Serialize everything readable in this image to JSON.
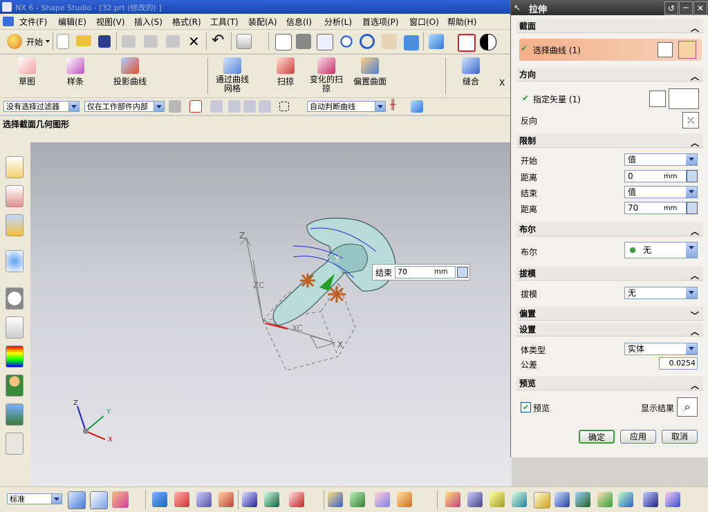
{
  "window": {
    "title": "NX 6 - Shape Studio - [32.prt (修改的) ]"
  },
  "menu": [
    "文件(F)",
    "编辑(E)",
    "视图(V)",
    "插入(S)",
    "格式(R)",
    "工具(T)",
    "装配(A)",
    "信息(I)",
    "分析(L)",
    "首选项(P)",
    "窗口(O)",
    "帮助(H)"
  ],
  "toolbar": {
    "start_label": "开始",
    "curve_buttons": [
      "草图",
      "样条",
      "投影曲线"
    ],
    "surface_buttons": [
      "通过曲线网格",
      "扫掠",
      "变化的扫掠",
      "偏置曲面",
      "缝合"
    ],
    "surface_extra": "X"
  },
  "selection_bar": {
    "filter": "没有选择过滤器",
    "scope": "仅在工作部件内部",
    "curve_rule": "自动判断曲线"
  },
  "cue": "选择截面几何图形",
  "viewport": {
    "axis_labels": {
      "z": "Z",
      "y": "Y",
      "x": "X",
      "zc": "ZC",
      "xc": "XC"
    },
    "triad": {
      "z": "Z",
      "y": "Y",
      "x": "X"
    },
    "onscreen_input": {
      "label": "结束",
      "value": "70",
      "unit": "mm"
    }
  },
  "dialog": {
    "title": "拉伸",
    "section": {
      "header": "截面",
      "select_curve": "选择曲线 (1)"
    },
    "direction": {
      "header": "方向",
      "specify_vector": "指定矢量 (1)",
      "reverse": "反向"
    },
    "limits": {
      "header": "限制",
      "start_label": "开始",
      "start_value": "值",
      "dist1_label": "距离",
      "dist1_value": "0",
      "dist1_unit": "mm",
      "end_label": "结束",
      "end_value": "值",
      "dist2_label": "距离",
      "dist2_value": "70",
      "dist2_unit": "mm"
    },
    "boolean": {
      "header": "布尔",
      "label": "布尔",
      "value": "无"
    },
    "draft": {
      "header": "拔模",
      "label": "拔模",
      "value": "无"
    },
    "offset": {
      "header": "偏置"
    },
    "settings": {
      "header": "设置",
      "body_type_label": "体类型",
      "body_type_value": "实体",
      "tolerance_label": "公差",
      "tolerance_value": "0.0254"
    },
    "preview": {
      "header": "预览",
      "checkbox_label": "预览",
      "show_result": "显示结果"
    },
    "buttons": {
      "ok": "确定",
      "apply": "应用",
      "cancel": "取消"
    }
  },
  "bottom": {
    "render_style": "标准"
  },
  "colors": {
    "accent": "#f2b48a",
    "title": "#2f63d6",
    "ok_border": "#3f9a3f"
  }
}
